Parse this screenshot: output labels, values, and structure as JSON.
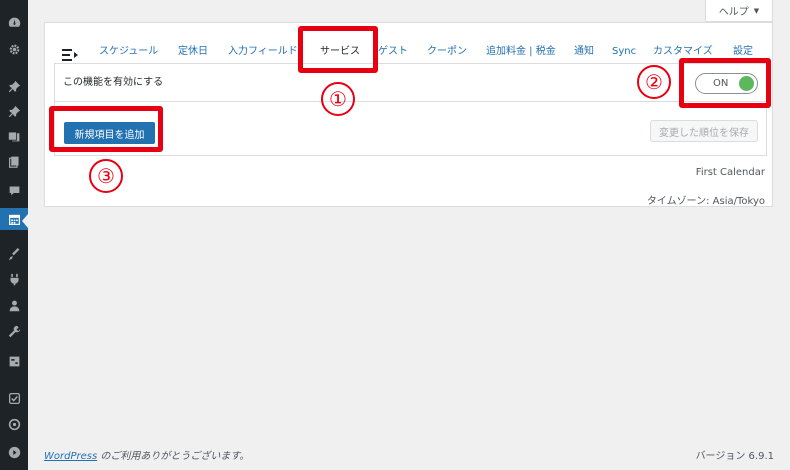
{
  "help": {
    "label": "ヘルプ",
    "chevron": "▼"
  },
  "tabs": [
    {
      "label": "スケジュール",
      "active": false
    },
    {
      "label": "定休日",
      "active": false
    },
    {
      "label": "入力フィールド",
      "active": false
    },
    {
      "label": "サービス",
      "active": true
    },
    {
      "label": "ゲスト",
      "active": false
    },
    {
      "label": "クーポン",
      "active": false
    },
    {
      "label": "追加料金 | 税金",
      "active": false
    },
    {
      "label": "通知",
      "active": false
    },
    {
      "label": "Sync",
      "active": false
    },
    {
      "label": "カスタマイズ",
      "active": false
    },
    {
      "label": "設定",
      "active": false
    }
  ],
  "settings": {
    "feature_label": "この機能を有効にする",
    "toggle_state": "ON",
    "add_button": "新規項目を追加",
    "save_order_button": "変更した順位を保存"
  },
  "calendar_name": "First Calendar",
  "timezone": "タイムゾーン: Asia/Tokyo",
  "markers": [
    "①",
    "②",
    "③"
  ],
  "footer": {
    "wordpress_link": "WordPress",
    "thanks_text": " のご利用ありがとうございます。",
    "version": "バージョン 6.9.1"
  },
  "sidebar_icons": [
    "dashboard-icon",
    "gear-icon",
    "pin-icon",
    "pin-icon",
    "media-icon",
    "pages-icon",
    "comments-icon",
    "calendar-icon",
    "appearance-icon",
    "plugins-icon",
    "users-icon",
    "tools-icon",
    "settings-icon",
    "check-icon",
    "circle-arrow-icon",
    "play-icon"
  ],
  "colors": {
    "accent": "#2271b1",
    "highlight": "#e60012",
    "toggle_on": "#5cb85c",
    "sidebar": "#1d2327"
  }
}
